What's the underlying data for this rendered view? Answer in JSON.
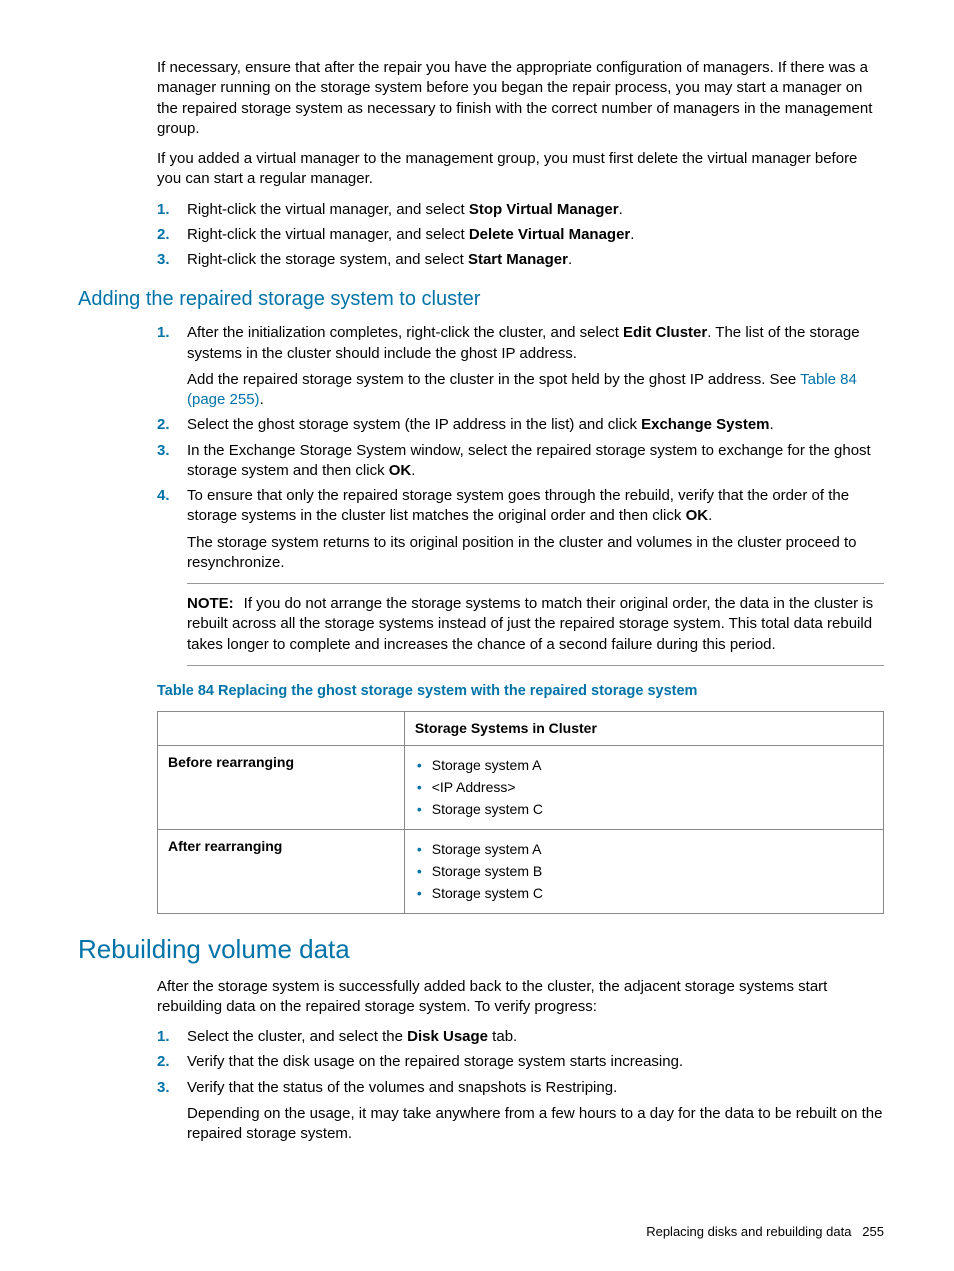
{
  "para1": "If necessary, ensure that after the repair you have the appropriate configuration of managers. If there was a manager running on the storage system before you began the repair process, you may start a manager on the repaired storage system as necessary to finish with the correct number of managers in the management group.",
  "para2": "If you added a virtual manager to the management group, you must first delete the virtual manager before you can start a regular manager.",
  "steps1": {
    "i1": {
      "n": "1.",
      "pre": "Right-click the virtual manager, and select ",
      "b": "Stop Virtual Manager",
      "post": "."
    },
    "i2": {
      "n": "2.",
      "pre": "Right-click the virtual manager, and select ",
      "b": "Delete Virtual Manager",
      "post": "."
    },
    "i3": {
      "n": "3.",
      "pre": "Right-click the storage system, and select ",
      "b": "Start Manager",
      "post": "."
    }
  },
  "heading_add": "Adding the repaired storage system to cluster",
  "steps2": {
    "i1": {
      "n": "1.",
      "pre": "After the initialization completes, right-click the cluster, and select ",
      "b": "Edit Cluster",
      "post": ". The list of the storage systems in the cluster should include the ghost IP address.",
      "sub_pre": "Add the repaired storage system to the cluster in the spot held by the ghost IP address. See ",
      "link": "Table 84 (page 255)",
      "sub_post": "."
    },
    "i2": {
      "n": "2.",
      "pre": "Select the ghost storage system (the IP address in the list) and click ",
      "b": "Exchange System",
      "post": "."
    },
    "i3": {
      "n": "3.",
      "pre": "In the Exchange Storage System window, select the repaired storage system to exchange for the ghost storage system and then click ",
      "b": "OK",
      "post": "."
    },
    "i4": {
      "n": "4.",
      "pre": "To ensure that only the repaired storage system goes through the rebuild, verify that the order of the storage systems in the cluster list matches the original order and then click ",
      "b": "OK",
      "post": ".",
      "sub": "The storage system returns to its original position in the cluster and volumes in the cluster proceed to resynchronize."
    }
  },
  "note": {
    "label": "NOTE:",
    "text": "If you do not arrange the storage systems to match their original order, the data in the cluster is rebuilt across all the storage systems instead of just the repaired storage system. This total data rebuild takes longer to complete and increases the chance of a second failure during this period."
  },
  "table": {
    "caption": "Table 84 Replacing the ghost storage system with the repaired storage system",
    "header_col1": "",
    "header_col2": "Storage Systems in Cluster",
    "row1": {
      "label": "Before rearranging",
      "items": {
        "a": "Storage system A",
        "b": "<IP Address>",
        "c": "Storage system C"
      }
    },
    "row2": {
      "label": "After rearranging",
      "items": {
        "a": "Storage system A",
        "b": "Storage system B",
        "c": "Storage system C"
      }
    }
  },
  "heading_rebuild": "Rebuilding volume data",
  "para3": "After the storage system is successfully added back to the cluster, the adjacent storage systems start rebuilding data on the repaired storage system. To verify progress:",
  "steps3": {
    "i1": {
      "n": "1.",
      "pre": "Select the cluster, and select the ",
      "b": "Disk Usage",
      "post": " tab."
    },
    "i2": {
      "n": "2.",
      "text": "Verify that the disk usage on the repaired storage system starts increasing."
    },
    "i3": {
      "n": "3.",
      "text": "Verify that the status of the volumes and snapshots is Restriping.",
      "sub": "Depending on the usage, it may take anywhere from a few hours to a day for the data to be rebuilt on the repaired storage system."
    }
  },
  "footer": {
    "text": "Replacing disks and rebuilding data",
    "page": "255"
  }
}
